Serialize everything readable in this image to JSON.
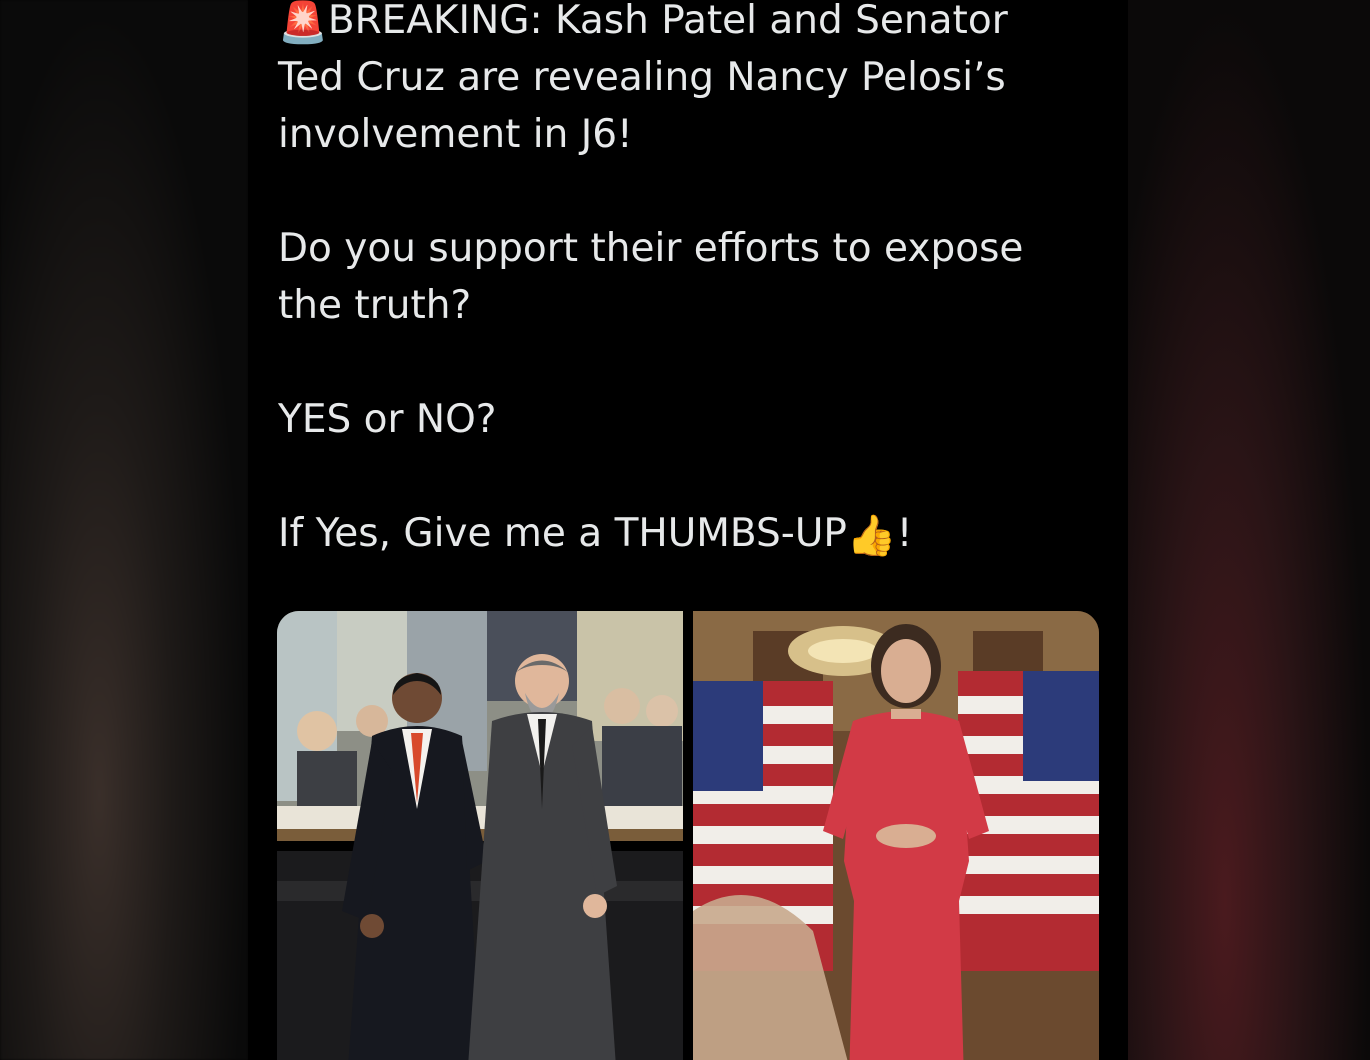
{
  "tweet": {
    "line1_emoji": "🚨",
    "line1_text": "BREAKING: Kash Patel and Senator Ted Cruz are revealing Nancy Pelosi’s involvement in J6!",
    "line2": "Do you support their efforts to expose the truth?",
    "line3": "YES or NO?",
    "line4_text": "If Yes, Give me a THUMBS-UP",
    "line4_emoji": "👍",
    "line4_end": "!"
  },
  "media": {
    "photos": [
      {
        "icon": "photo-two-men-office"
      },
      {
        "icon": "photo-woman-red-dress-flags"
      }
    ]
  },
  "colors": {
    "background": "#000000",
    "text": "#e7e9ea"
  }
}
